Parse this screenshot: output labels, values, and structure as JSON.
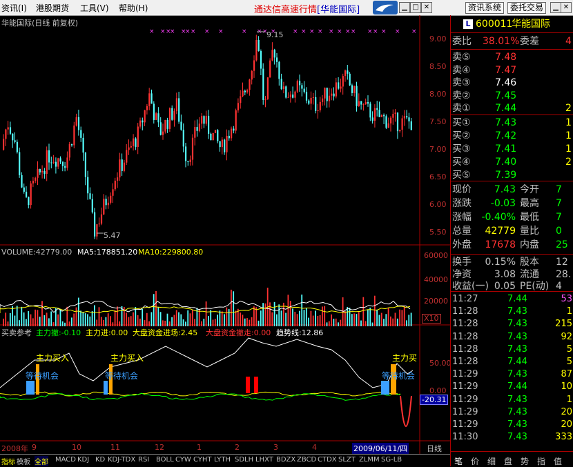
{
  "menu": {
    "items": [
      "资讯(I)",
      "港股期货",
      "工具(V)",
      "帮助(H)"
    ],
    "title_main": "通达信高速行情",
    "title_sub": "[华能国际]",
    "buttons": [
      "资讯系统",
      "委托交易"
    ],
    "window_controls": [
      "▁",
      "□",
      "✕"
    ]
  },
  "main_chart": {
    "title": "华能国际(日线 前复权)",
    "y_ticks": [
      "9.00",
      "8.50",
      "8.00",
      "7.50",
      "7.00",
      "6.50",
      "6.00",
      "5.50"
    ],
    "high_label": "9.15",
    "low_label": "5.47",
    "colors": {
      "up": "#ff3232",
      "down": "#54ffff",
      "bg": "#000000",
      "axis": "#aa0000"
    }
  },
  "volume_chart": {
    "label": "VOLUME:42779.00",
    "ma5": "MA5:178851.20",
    "ma10": "MA10:229800.80",
    "y_ticks": [
      "60000",
      "40000",
      "20000"
    ],
    "multiplier": "X10"
  },
  "indicator": {
    "name": "买卖参考",
    "params": [
      {
        "text": "主力撤:-0.10",
        "color": "#00ff00"
      },
      {
        "text": "主力进:0.00",
        "color": "#ffff00"
      },
      {
        "text": "大盘资金进场:2.45",
        "color": "#ffff00"
      },
      {
        "text": "大盘资金撤走:0.00",
        "color": "#ff3232"
      },
      {
        "text": "趋势线:12.86",
        "color": "#ffffff"
      }
    ],
    "y_ticks": [
      "50.00",
      "0.00"
    ],
    "current_value": "-20.31",
    "annotations": {
      "buy": "主力买入",
      "buy_clipped": "主力买",
      "wait": "等待机会",
      "wait_clipped": "等待机会"
    }
  },
  "time_axis": {
    "labels": [
      "2008年",
      "9",
      "10",
      "11",
      "12",
      "1",
      "2",
      "3",
      "4",
      "5"
    ],
    "current_date": "2009/06/11/四",
    "period": "日线"
  },
  "bottom_tabs": [
    "指标",
    "模板",
    "全部",
    "MACD",
    "KDJ",
    "KD",
    "KDJ-TDX",
    "RSI",
    "BOLL",
    "CYW",
    "CYHT",
    "LYTH",
    "SDLH",
    "LHXT",
    "BDZX",
    "ZBCD",
    "CTDX",
    "SLZT",
    "ZLMM",
    "SG-LB"
  ],
  "quote": {
    "code": "600011",
    "name": "华能国际",
    "weibi_label": "委比",
    "weibi": "38.01%",
    "weicha_label": "委差",
    "weicha": "4",
    "sell": [
      {
        "label": "卖⑤",
        "price": "7.48",
        "vol": ""
      },
      {
        "label": "卖④",
        "price": "7.47",
        "vol": ""
      },
      {
        "label": "卖③",
        "price": "7.46",
        "vol": ""
      },
      {
        "label": "卖②",
        "price": "7.45",
        "vol": ""
      },
      {
        "label": "卖①",
        "price": "7.44",
        "vol": "2"
      }
    ],
    "buy": [
      {
        "label": "买①",
        "price": "7.43",
        "vol": "1"
      },
      {
        "label": "买②",
        "price": "7.42",
        "vol": "1"
      },
      {
        "label": "买③",
        "price": "7.41",
        "vol": "1"
      },
      {
        "label": "买④",
        "price": "7.40",
        "vol": "2"
      },
      {
        "label": "买⑤",
        "price": "7.39",
        "vol": ""
      }
    ],
    "stats": [
      {
        "l1": "现价",
        "v1": "7.43",
        "c1": "#00ff00",
        "l2": "今开",
        "v2": "7"
      },
      {
        "l1": "涨跌",
        "v1": "-0.03",
        "c1": "#00ff00",
        "l2": "最高",
        "v2": "7"
      },
      {
        "l1": "涨幅",
        "v1": "-0.40%",
        "c1": "#00ff00",
        "l2": "最低",
        "v2": "7"
      },
      {
        "l1": "总量",
        "v1": "42779",
        "c1": "#ffff00",
        "l2": "量比",
        "v2": "0"
      },
      {
        "l1": "外盘",
        "v1": "17678",
        "c1": "#ff3232",
        "l2": "内盘",
        "v2": "25"
      }
    ],
    "stats2": [
      {
        "l1": "换手",
        "v1": "0.15%",
        "l2": "股本",
        "v2": "12"
      },
      {
        "l1": "净资",
        "v1": "3.08",
        "l2": "流通",
        "v2": "28."
      },
      {
        "l1": "收益(一)",
        "v1": "0.05",
        "l2": "PE(动)",
        "v2": "4"
      }
    ],
    "ticks": [
      {
        "time": "11:27",
        "price": "7.44",
        "vol": "53",
        "vc": "#ff55ff"
      },
      {
        "time": "11:28",
        "price": "7.43",
        "vol": "1",
        "vc": "#ffff00"
      },
      {
        "time": "11:28",
        "price": "7.43",
        "vol": "215",
        "vc": "#ffff00"
      },
      {
        "time": "11:28",
        "price": "7.43",
        "vol": "92",
        "vc": "#ffff00"
      },
      {
        "time": "11:28",
        "price": "7.43",
        "vol": "5",
        "vc": "#ffff00"
      },
      {
        "time": "11:28",
        "price": "7.44",
        "vol": "5",
        "vc": "#ffff00"
      },
      {
        "time": "11:29",
        "price": "7.43",
        "vol": "87",
        "vc": "#ffff00"
      },
      {
        "time": "11:29",
        "price": "7.44",
        "vol": "10",
        "vc": "#ffff00"
      },
      {
        "time": "11:29",
        "price": "7.43",
        "vol": "1",
        "vc": "#ffff00"
      },
      {
        "time": "11:29",
        "price": "7.43",
        "vol": "20",
        "vc": "#ffff00"
      },
      {
        "time": "11:29",
        "price": "7.43",
        "vol": "20",
        "vc": "#ffff00"
      },
      {
        "time": "11:30",
        "price": "7.43",
        "vol": "333",
        "vc": "#ffff00"
      }
    ],
    "tabs": [
      "笔",
      "价",
      "细",
      "盘",
      "势",
      "指",
      "值"
    ]
  }
}
